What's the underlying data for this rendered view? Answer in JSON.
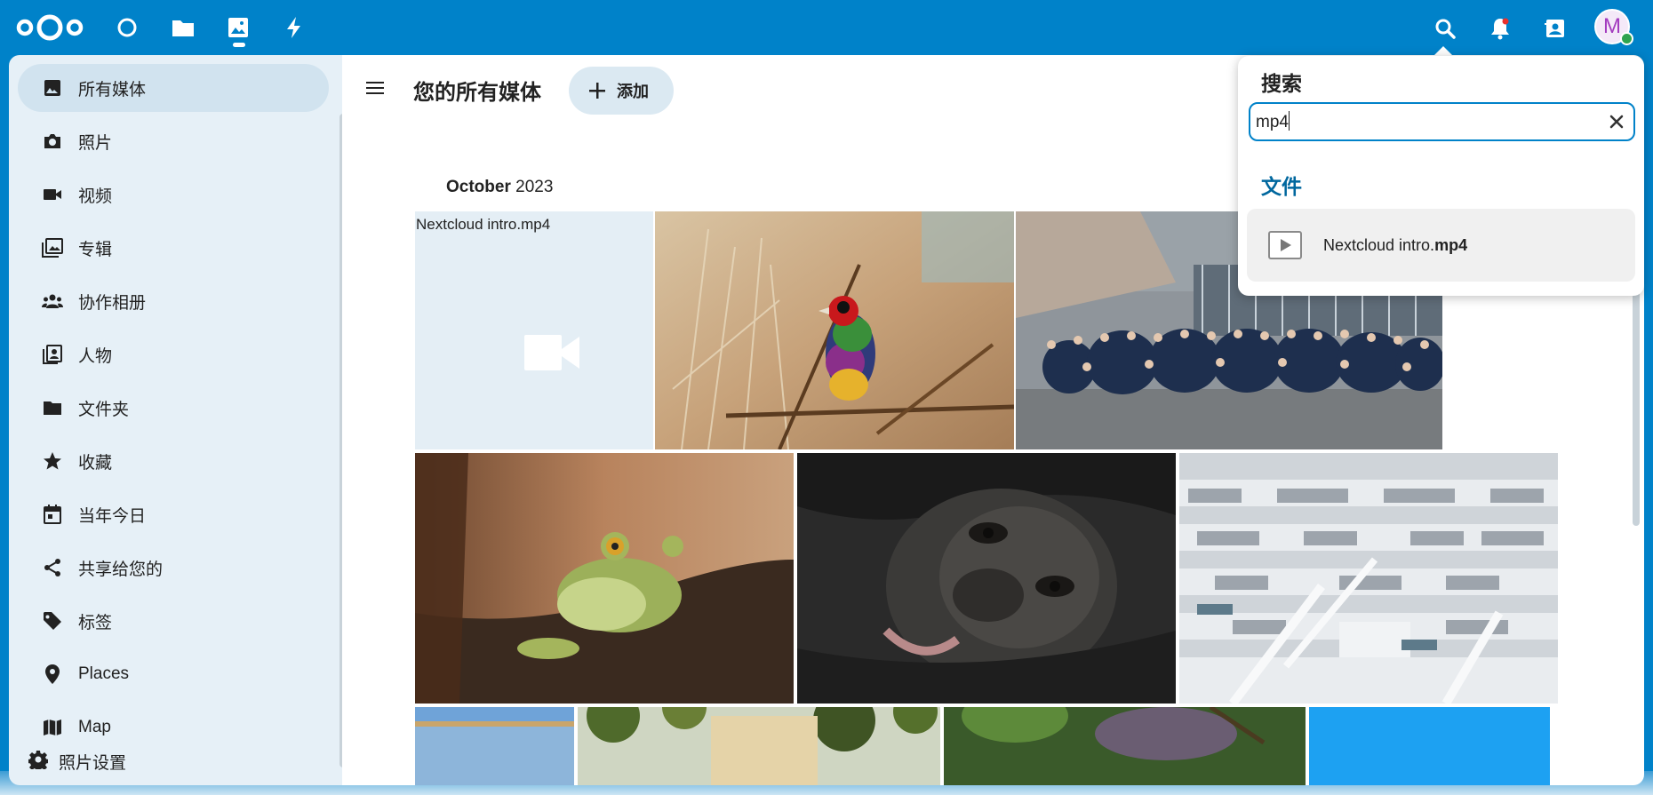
{
  "header": {
    "apps": [
      {
        "name": "dashboard",
        "icon": "circle-dashboard-icon"
      },
      {
        "name": "files",
        "icon": "folder-icon"
      },
      {
        "name": "photos",
        "icon": "image-icon",
        "active": true
      },
      {
        "name": "activity",
        "icon": "lightning-icon"
      }
    ],
    "right_icons": [
      "search-icon",
      "bell-icon",
      "contacts-icon"
    ],
    "avatar_letter": "M",
    "colors": {
      "brand": "#0082c9",
      "status_online": "#2ea44f",
      "avatar": "#a33bbf"
    }
  },
  "nav": {
    "items": [
      {
        "label": "所有媒体",
        "icon": "image-icon",
        "active": true
      },
      {
        "label": "照片",
        "icon": "camera-icon"
      },
      {
        "label": "视频",
        "icon": "video-icon"
      },
      {
        "label": "专辑",
        "icon": "album-icon"
      },
      {
        "label": "协作相册",
        "icon": "people-icon"
      },
      {
        "label": "人物",
        "icon": "person-card-icon"
      },
      {
        "label": "文件夹",
        "icon": "folder-icon"
      },
      {
        "label": "收藏",
        "icon": "star-icon"
      },
      {
        "label": "当年今日",
        "icon": "calendar-icon"
      },
      {
        "label": "共享给您的",
        "icon": "share-icon"
      },
      {
        "label": "标签",
        "icon": "tag-icon"
      },
      {
        "label": "Places",
        "icon": "map-pin-icon"
      },
      {
        "label": "Map",
        "icon": "map-icon"
      }
    ],
    "settings_label": "照片设置"
  },
  "main": {
    "title": "您的所有媒体",
    "add_label": "添加",
    "month": "October",
    "year": "2023",
    "video_filename": "Nextcloud intro.mp4"
  },
  "search": {
    "title": "搜索",
    "query": "mp4",
    "section_title": "文件",
    "result": {
      "name_prefix": "Nextcloud intro.",
      "name_match": "mp4"
    }
  }
}
